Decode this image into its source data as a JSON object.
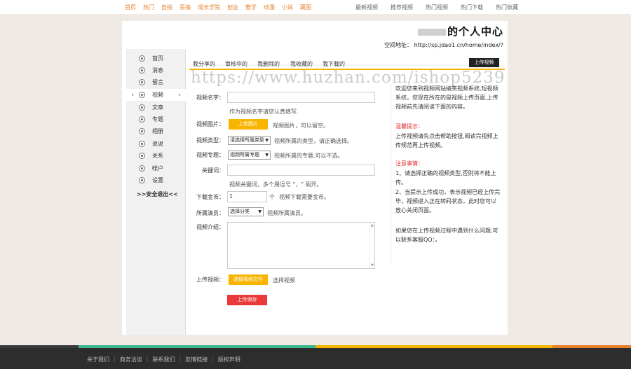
{
  "topnav": {
    "left": [
      "首页",
      "热门",
      "自拍",
      "恶搞",
      "成长学院",
      "创业",
      "教学",
      "动漫",
      "小说",
      "藏图"
    ],
    "right": [
      "最新视频",
      "推荐视频",
      "热门视频",
      "热门下载",
      "热门收藏"
    ]
  },
  "header": {
    "title": "的个人中心",
    "address": "空间地址：  http://sp.jdao1.cn/home/index/?"
  },
  "sidebar": {
    "items": [
      "首页",
      "消息",
      "留言",
      "视频",
      "文章",
      "专题",
      "相册",
      "说说",
      "关系",
      "帐户",
      "设置"
    ],
    "logout": ">>安全退出<<"
  },
  "tabs": [
    "我分享的",
    "审核中的",
    "我删除的",
    "我收藏的",
    "我下载的"
  ],
  "upload_button": "上传视频",
  "watermark": "https://www.huzhan.com/ishop5239",
  "form": {
    "name_label": "视频名字：",
    "name_hint": "作为视频名字请您认真填写.",
    "image_label": "视频图片：",
    "image_button": "上传图片",
    "image_hint": "视频图片，可以留空。",
    "type_label": "视频类型：",
    "type_select": "请选择所属类型",
    "type_hint": "视频所属的类型，请正确选择。",
    "topic_label": "视频专题：",
    "topic_select": "视频所属专题",
    "topic_hint": "视频所属的专题,可以不选。",
    "keyword_label": "关键词：",
    "keyword_hint": "视频关键词，多个用逗号 \"，\" 阁开。",
    "coin_label": "下载金币：",
    "coin_value": "1",
    "coin_unit": "个",
    "coin_hint": "视频下载需要金币。",
    "actor_label": "所属演员：",
    "actor_select": "选择分类",
    "actor_hint": "视频所属演员。",
    "intro_label": "视频介绍：",
    "upload_label": "上传视频：",
    "upload_file_button": "选择视频文件",
    "upload_file_hint": "选择视频",
    "save_button": "上传保存"
  },
  "info": {
    "welcome": "欢迎您来到视频网站搞笑视频系统,短视频系统，您现在所在的是视频上传页面,上传视频前先请阅读下面的内容。",
    "tip_title": "温馨提示：",
    "tip_body": "上传视频请先点击帮助按钮,阅读完视频上传规范再上传视频。",
    "notice_title": "注意事情：",
    "notice_1": "1、请选择正确的视频类型,否则将不能上传。",
    "notice_2": "2、当提示上传成功，表示视频已经上传完毕，视频进入正在转码状态，此时您可以放心关闭页面。",
    "contact": "如果您在上传视频过程中遇到什么问题,可以联系客服QQ：。"
  },
  "footer": {
    "links": [
      "关于我们",
      "商务洽谈",
      "联系我们",
      "友情链接",
      "版权声明"
    ]
  },
  "colors": {
    "accent": "#f7b500",
    "nav_orange": "#e8802a",
    "save_red": "#e83a3a",
    "footer_bg": "#2d2d2d"
  }
}
